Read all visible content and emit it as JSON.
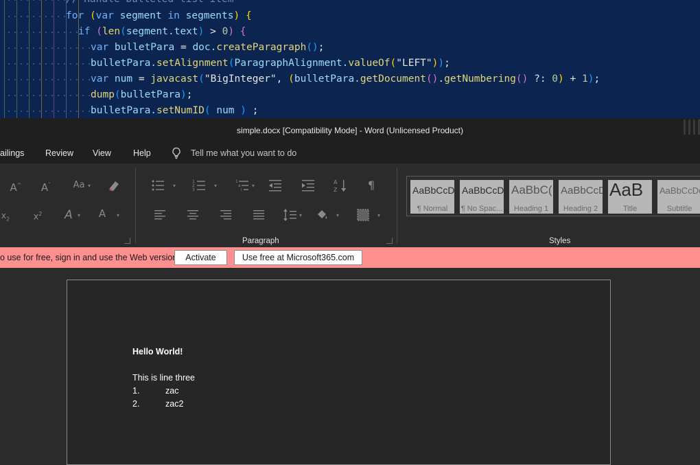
{
  "editor": {
    "lines": [
      [
        {
          "t": "// Handle bulleted list item",
          "c": "comment"
        }
      ],
      [
        {
          "t": "for",
          "c": "kw"
        },
        {
          "t": " ",
          "c": "plain"
        },
        {
          "t": "(",
          "c": "p1"
        },
        {
          "t": "var",
          "c": "kw"
        },
        {
          "t": " segment ",
          "c": "var"
        },
        {
          "t": "in",
          "c": "kw"
        },
        {
          "t": " segments",
          "c": "var"
        },
        {
          "t": ")",
          "c": "p1"
        },
        {
          "t": " ",
          "c": "plain"
        },
        {
          "t": "{",
          "c": "p1"
        }
      ],
      [
        {
          "t": "if",
          "c": "kw"
        },
        {
          "t": " ",
          "c": "plain"
        },
        {
          "t": "(",
          "c": "p2"
        },
        {
          "t": "len",
          "c": "fn"
        },
        {
          "t": "(",
          "c": "p3"
        },
        {
          "t": "segment.text",
          "c": "var"
        },
        {
          "t": ")",
          "c": "p3"
        },
        {
          "t": " > ",
          "c": "plain"
        },
        {
          "t": "0",
          "c": "num"
        },
        {
          "t": ")",
          "c": "p2"
        },
        {
          "t": " ",
          "c": "plain"
        },
        {
          "t": "{",
          "c": "p2"
        }
      ],
      [
        {
          "t": "var",
          "c": "kw"
        },
        {
          "t": " bulletPara ",
          "c": "var"
        },
        {
          "t": "= ",
          "c": "plain"
        },
        {
          "t": "doc.",
          "c": "var"
        },
        {
          "t": "createParagraph",
          "c": "fn"
        },
        {
          "t": "()",
          "c": "p3"
        },
        {
          "t": ";",
          "c": "plain"
        }
      ],
      [
        {
          "t": "bulletPara.",
          "c": "var"
        },
        {
          "t": "setAlignment",
          "c": "fn"
        },
        {
          "t": "(",
          "c": "p3"
        },
        {
          "t": "ParagraphAlignment.",
          "c": "var"
        },
        {
          "t": "valueOf",
          "c": "fn"
        },
        {
          "t": "(",
          "c": "p1"
        },
        {
          "t": "\"LEFT\"",
          "c": "str"
        },
        {
          "t": ")",
          "c": "p1"
        },
        {
          "t": ")",
          "c": "p3"
        },
        {
          "t": ";",
          "c": "plain"
        }
      ],
      [
        {
          "t": "var",
          "c": "kw"
        },
        {
          "t": " num ",
          "c": "var"
        },
        {
          "t": "= ",
          "c": "plain"
        },
        {
          "t": "javacast",
          "c": "fn"
        },
        {
          "t": "(",
          "c": "p3"
        },
        {
          "t": "\"BigInteger\"",
          "c": "str"
        },
        {
          "t": ", ",
          "c": "plain"
        },
        {
          "t": "(",
          "c": "p1"
        },
        {
          "t": "bulletPara.",
          "c": "var"
        },
        {
          "t": "getDocument",
          "c": "fn"
        },
        {
          "t": "()",
          "c": "p2"
        },
        {
          "t": ".",
          "c": "plain"
        },
        {
          "t": "getNumbering",
          "c": "fn"
        },
        {
          "t": "()",
          "c": "p2"
        },
        {
          "t": " ?: ",
          "c": "plain"
        },
        {
          "t": "0",
          "c": "num"
        },
        {
          "t": ")",
          "c": "p1"
        },
        {
          "t": " + ",
          "c": "plain"
        },
        {
          "t": "1",
          "c": "num"
        },
        {
          "t": ")",
          "c": "p3"
        },
        {
          "t": ";",
          "c": "plain"
        }
      ],
      [
        {
          "t": "dump",
          "c": "fn"
        },
        {
          "t": "(",
          "c": "p3"
        },
        {
          "t": "bulletPara",
          "c": "var"
        },
        {
          "t": ")",
          "c": "p3"
        },
        {
          "t": ";",
          "c": "plain"
        }
      ],
      [
        {
          "t": "bulletPara.",
          "c": "var"
        },
        {
          "t": "setNumID",
          "c": "fn"
        },
        {
          "t": "(",
          "c": "p3"
        },
        {
          "t": " num ",
          "c": "var"
        },
        {
          "t": ")",
          "c": "p3"
        },
        {
          "t": " ;",
          "c": "plain"
        }
      ]
    ]
  },
  "window": {
    "title": "simple.docx [Compatibility Mode]  -  Word (Unlicensed Product)"
  },
  "ribbon": {
    "tabs": [
      "ailings",
      "Review",
      "View",
      "Help"
    ],
    "tell_me": "Tell me what you want to do",
    "groups": {
      "paragraph": "Paragraph",
      "styles": "Styles"
    },
    "styles": [
      {
        "preview": "AaBbCcD",
        "name": "¶ Normal"
      },
      {
        "preview": "AaBbCcD",
        "name": "¶ No Spac..."
      },
      {
        "preview": "AaBbC(",
        "name": "Heading 1"
      },
      {
        "preview": "AaBbCcD",
        "name": "Heading 2"
      },
      {
        "preview": "AaB",
        "name": "Title"
      },
      {
        "preview": "AaBbCcDc",
        "name": "Subtitle"
      }
    ]
  },
  "notification": {
    "text": "o use for free, sign in and use the Web version.",
    "activate_label": "Activate",
    "web_label": "Use free at Microsoft365.com"
  },
  "document": {
    "heading": "Hello World!",
    "line": "This is line three",
    "list": [
      {
        "num": "1.",
        "text": "zac"
      },
      {
        "num": "2.",
        "text": "zac2"
      }
    ]
  }
}
